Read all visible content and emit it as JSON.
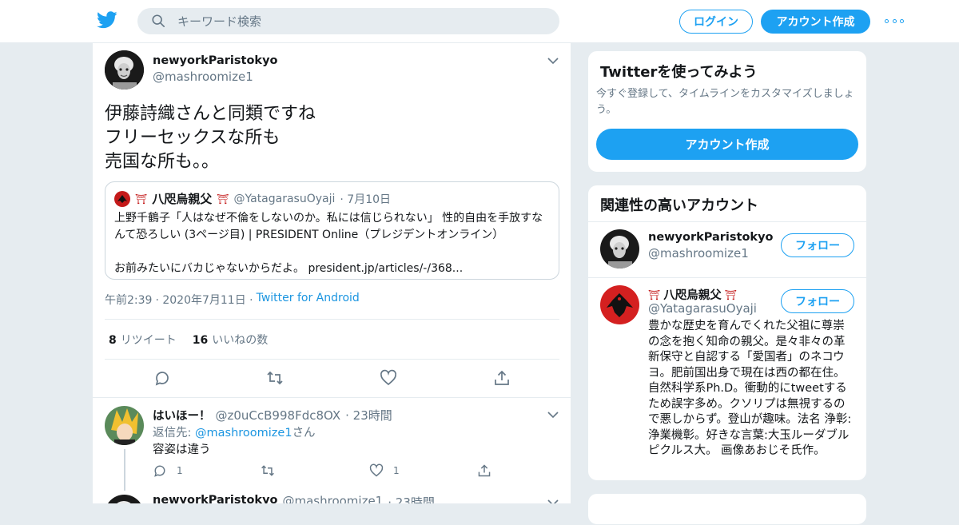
{
  "header": {
    "search_placeholder": "キーワード検索",
    "login_label": "ログイン",
    "signup_label": "アカウント作成",
    "accent": "#1da1f2"
  },
  "tweet": {
    "author_name": "newyorkParistokyo",
    "author_handle": "@mashroomize1",
    "text": "伊藤詩織さんと同類ですね\nフリーセックスな所も\n売国な所も。。",
    "quote": {
      "name": "八咫烏親父",
      "handle": "@YatagarasuOyaji",
      "date": "· 7月10日",
      "text": "上野千鶴子「人はなぜ不倫をしないのか。私には信じられない」 性的自由を手放すなんて恐ろしい (3ページ目) | PRESIDENT Online（プレジデントオンライン）\n\nお前みたいにバカじゃないからだよ。 president.jp/articles/-/368..."
    },
    "time": "午前2:39",
    "date": "· 2020年7月11日 ·",
    "via": "Twitter for Android",
    "retweets_count": "8",
    "retweets_label": "リツイート",
    "likes_count": "16",
    "likes_label": "いいねの数"
  },
  "reply": {
    "name": "はいほー！",
    "handle": "@z0uCcB998Fdc8OX",
    "time": "· 23時間",
    "reply_prefix": "返信先: ",
    "reply_to": "@mashroomize1",
    "reply_suffix": "さん",
    "text": "容姿は違う",
    "reply_count": "1",
    "like_count": "1"
  },
  "third": {
    "name": "newyorkParistokyo",
    "handle": "@mashroomize1",
    "time": "· 23時間"
  },
  "sidebar": {
    "try_title": "Twitterを使ってみよう",
    "try_sub": "今すぐ登録して、タイムラインをカスタマイズしましょう。",
    "try_button": "アカウント作成",
    "related_title": "関連性の高いアカウント",
    "follow_label": "フォロー",
    "accounts": [
      {
        "name": "newyorkParistokyo",
        "handle": "@mashroomize1"
      },
      {
        "name": "八咫烏親父",
        "handle": "@YatagarasuOyaji",
        "bio": "豊かな歴史を育んでくれた父祖に尊崇の念を抱く知命の親父。是々非々の革新保守と自認する「愛国者」のネコウヨ。肥前国出身で現在は西の都在住。自然科学系Ph.D。衝動的にtweetするため誤字多め。クソリプは無視するので悪しからず。登山が趣味。法名 浄彰: 浄業機彰。好きな言葉:大玉ルーダブルピクルス大。 画像あおじそ氏作。"
      }
    ]
  }
}
